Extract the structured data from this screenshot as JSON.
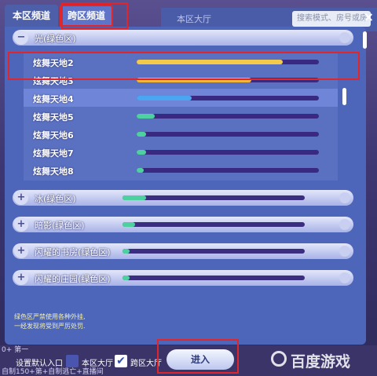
{
  "window": {
    "tabs": [
      {
        "label": "本区频道",
        "active": false
      },
      {
        "label": "跨区频道",
        "active": true
      }
    ],
    "background_title": "本区大厅",
    "search_placeholder": "搜索模式、房号或房",
    "close_symbol": "×"
  },
  "groups": [
    {
      "label": "光(绿色区)",
      "expanded": true,
      "toggle_symbol": "−",
      "rooms": [
        {
          "label": "炫舞天地2",
          "fill": 0.8,
          "color": "#f2c94a",
          "selected": false
        },
        {
          "label": "炫舞天地3",
          "fill": 0.63,
          "color": "#f2b53a",
          "selected": false
        },
        {
          "label": "炫舞天地4",
          "fill": 0.3,
          "color": "#4aa6f0",
          "selected": true
        },
        {
          "label": "炫舞天地5",
          "fill": 0.1,
          "color": "#4fd0a0",
          "selected": false
        },
        {
          "label": "炫舞天地6",
          "fill": 0.05,
          "color": "#4fd0a0",
          "selected": false
        },
        {
          "label": "炫舞天地7",
          "fill": 0.05,
          "color": "#4fd0a0",
          "selected": false
        },
        {
          "label": "炫舞天地8",
          "fill": 0.04,
          "color": "#4fd0a0",
          "selected": false
        }
      ]
    },
    {
      "label": "冰(绿色区)",
      "expanded": false,
      "toggle_symbol": "+",
      "fill": 0.13
    },
    {
      "label": "暗影(绿色区)",
      "expanded": false,
      "toggle_symbol": "+",
      "fill": 0.07
    },
    {
      "label": "闪耀的书房(绿色区)",
      "expanded": false,
      "toggle_symbol": "+",
      "fill": 0.04
    },
    {
      "label": "闪耀的庄园(绿色区)",
      "expanded": false,
      "toggle_symbol": "+",
      "fill": 0.04
    }
  ],
  "notice": {
    "line1": "绿色区严禁使用各种外挂,",
    "line2": "一经发现将受到严厉处罚."
  },
  "bottom": {
    "default_entry_label": "设置默认入口",
    "local_hall_label": "本区大厅",
    "cross_hall_label": "跨区大厅",
    "enter_button": "进入",
    "local_hall_checked": false,
    "cross_hall_checked": true
  },
  "background_chat": {
    "line1": "0+ 第一",
    "line2": "自制150+第+自制逃亡+直播间"
  },
  "watermark": "百度游戏",
  "colors": {
    "panel": "#4e66b9",
    "highlight_red": "#e0262a",
    "bar_track": "#3a2980"
  }
}
